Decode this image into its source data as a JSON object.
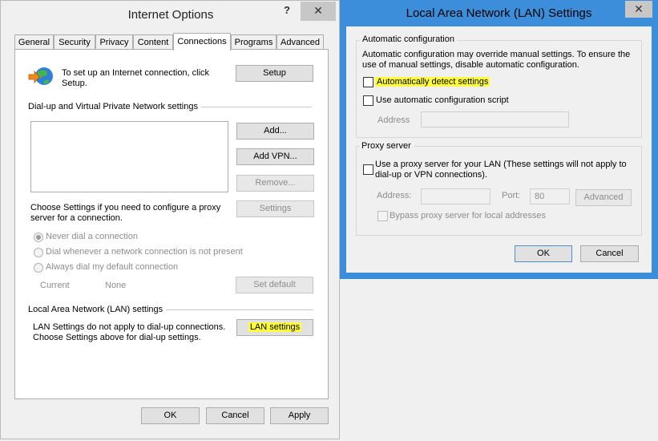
{
  "io": {
    "title": "Internet Options",
    "help": "?",
    "close": "✕",
    "tabs": [
      "General",
      "Security",
      "Privacy",
      "Content",
      "Connections",
      "Programs",
      "Advanced"
    ],
    "setup_text_1": "To set up an Internet connection, click",
    "setup_text_2": "Setup.",
    "setup_button": "Setup",
    "dialup_group": "Dial-up and Virtual Private Network settings",
    "add_button": "Add...",
    "add_vpn_button": "Add VPN...",
    "remove_button": "Remove...",
    "settings_text_1": "Choose Settings if you need to configure a proxy",
    "settings_text_2": "server for a connection.",
    "settings_button": "Settings",
    "radio_never": "Never dial a connection",
    "radio_whenever": "Dial whenever a network connection is not present",
    "radio_always": "Always dial my default connection",
    "current_label": "Current",
    "current_value": "None",
    "set_default_button": "Set default",
    "lan_group": "Local Area Network (LAN) settings",
    "lan_text_1": "LAN Settings do not apply to dial-up connections.",
    "lan_text_2": "Choose Settings above for dial-up settings.",
    "lan_settings_button": "LAN settings",
    "ok_button": "OK",
    "cancel_button": "Cancel",
    "apply_button": "Apply"
  },
  "lan": {
    "title": "Local Area Network (LAN) Settings",
    "close": "✕",
    "auto_group": "Automatic configuration",
    "auto_desc_1": "Automatic configuration may override manual settings.  To ensure the",
    "auto_desc_2": "use of manual settings, disable automatic configuration.",
    "auto_detect": "Automatically detect settings",
    "auto_script": "Use automatic configuration script",
    "address_label": "Address",
    "proxy_group": "Proxy server",
    "proxy_use_1": "Use a proxy server for your LAN (These settings will not apply to",
    "proxy_use_2": "dial-up or VPN connections).",
    "proxy_address_label": "Address:",
    "port_label": "Port:",
    "port_value": "80",
    "advanced_button": "Advanced",
    "bypass_label": "Bypass proxy server for local addresses",
    "ok_button": "OK",
    "cancel_button": "Cancel"
  },
  "colors": {
    "highlight": "#ffff3a",
    "lan_border": "#3c8edb"
  },
  "icons": {
    "setup": "globe-connection-icon"
  }
}
